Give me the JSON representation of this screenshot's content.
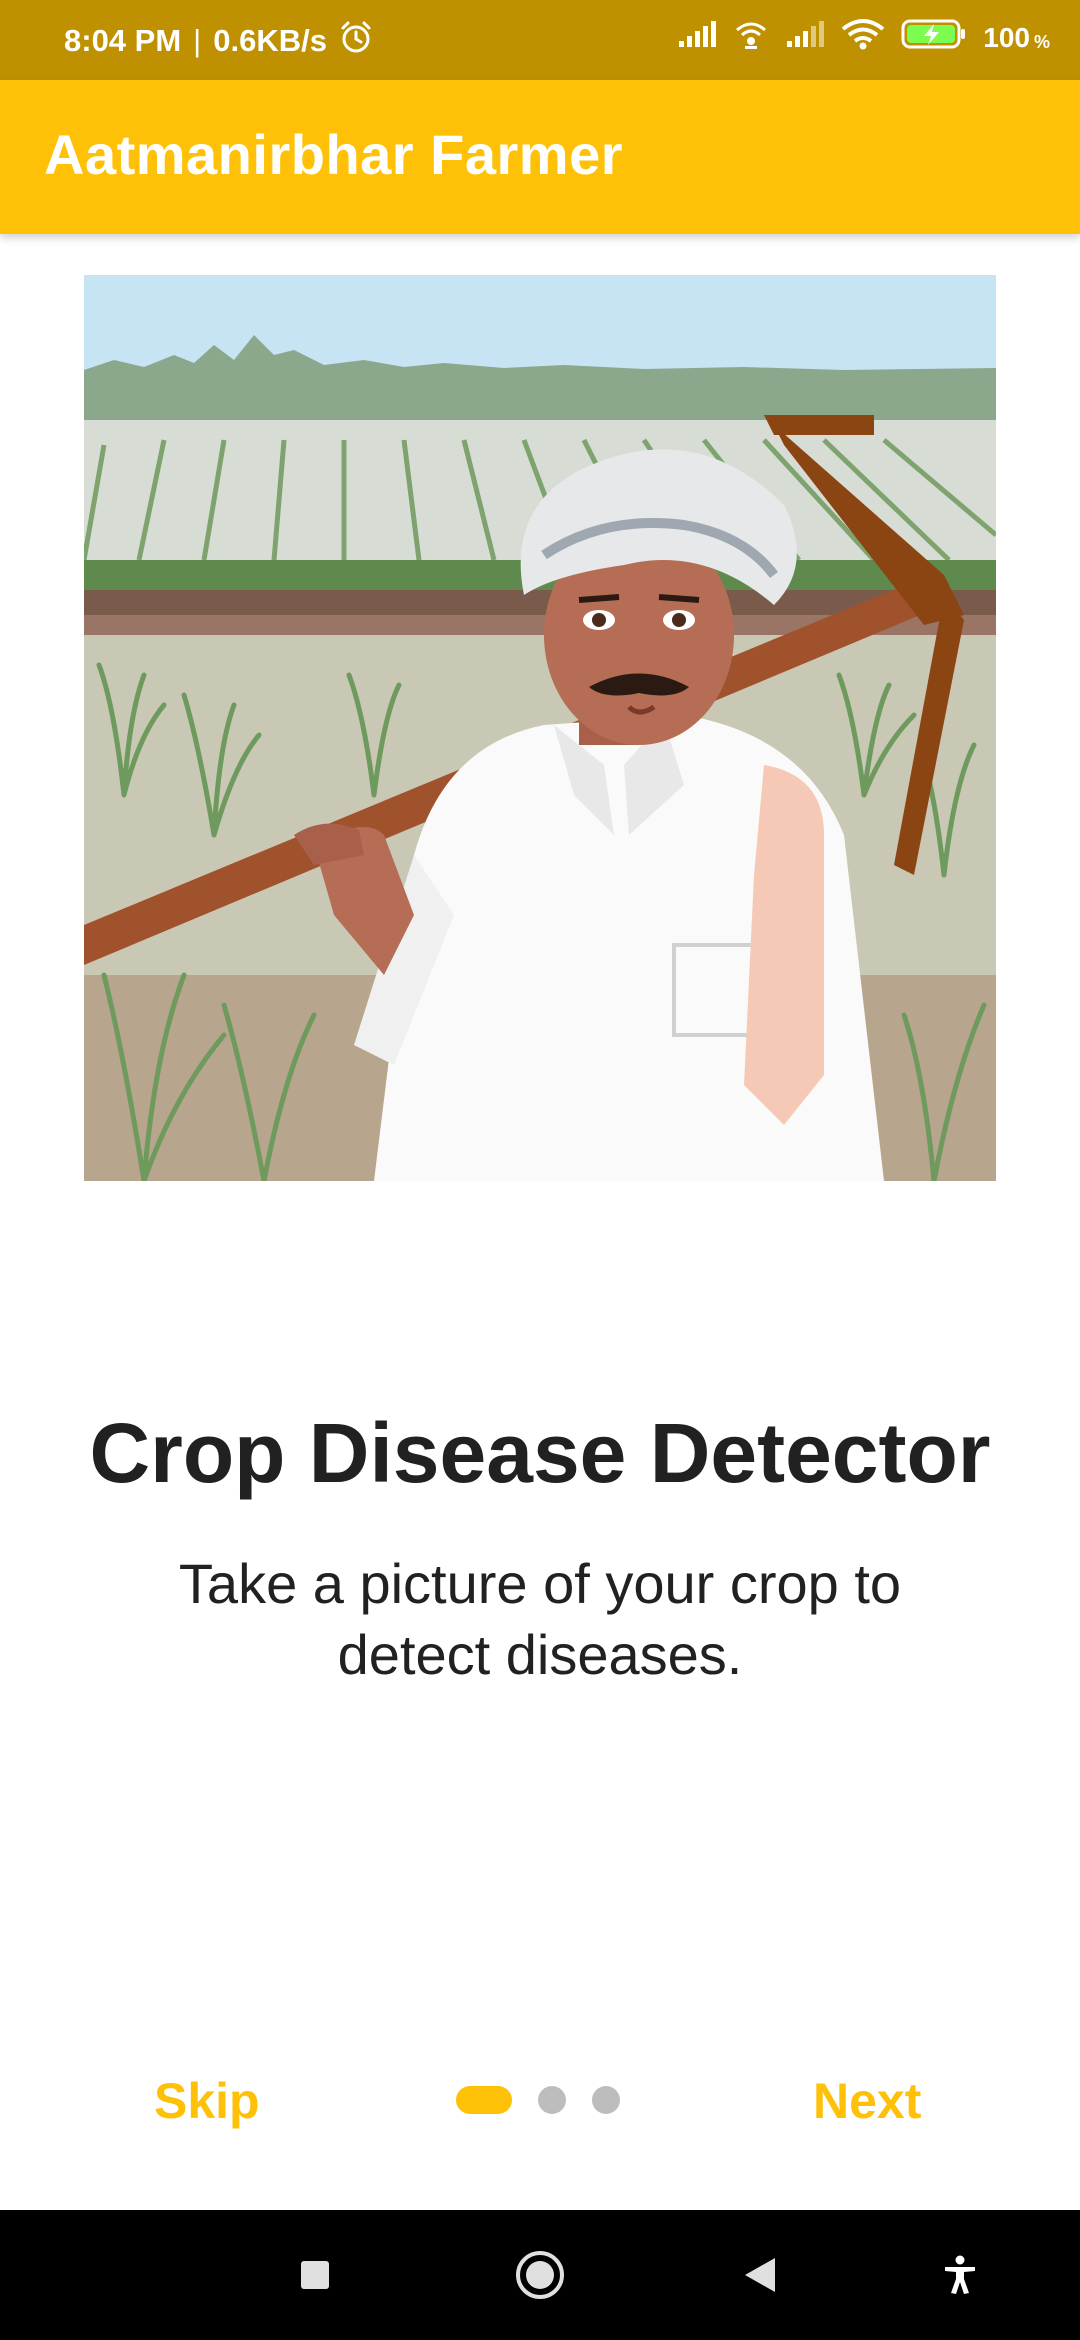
{
  "status_bar": {
    "time": "8:04 PM",
    "network_speed": "0.6KB/s",
    "separator": "|",
    "battery_percent": "100",
    "battery_unit": "%",
    "icons": [
      "alarm-icon",
      "signal-icon",
      "wifi-calling-icon",
      "signal-icon",
      "wifi-icon",
      "battery-charging-icon"
    ]
  },
  "app_bar": {
    "title": "Aatmanirbhar Farmer"
  },
  "onboarding": {
    "illustration": "farmer-with-plough-illustration",
    "title": "Crop Disease Detector",
    "description": "Take a picture of your crop to detect diseases.",
    "page_index": 1,
    "page_count": 3
  },
  "navigation": {
    "skip_label": "Skip",
    "next_label": "Next"
  },
  "system_nav": {
    "icons": [
      "recents-icon",
      "home-icon",
      "back-icon",
      "accessibility-icon"
    ]
  },
  "colors": {
    "status_bar": "#BF9000",
    "app_bar": "#FFC107",
    "accent": "#FFC107",
    "inactive_dot": "#BDBDBD",
    "text": "#212121"
  }
}
